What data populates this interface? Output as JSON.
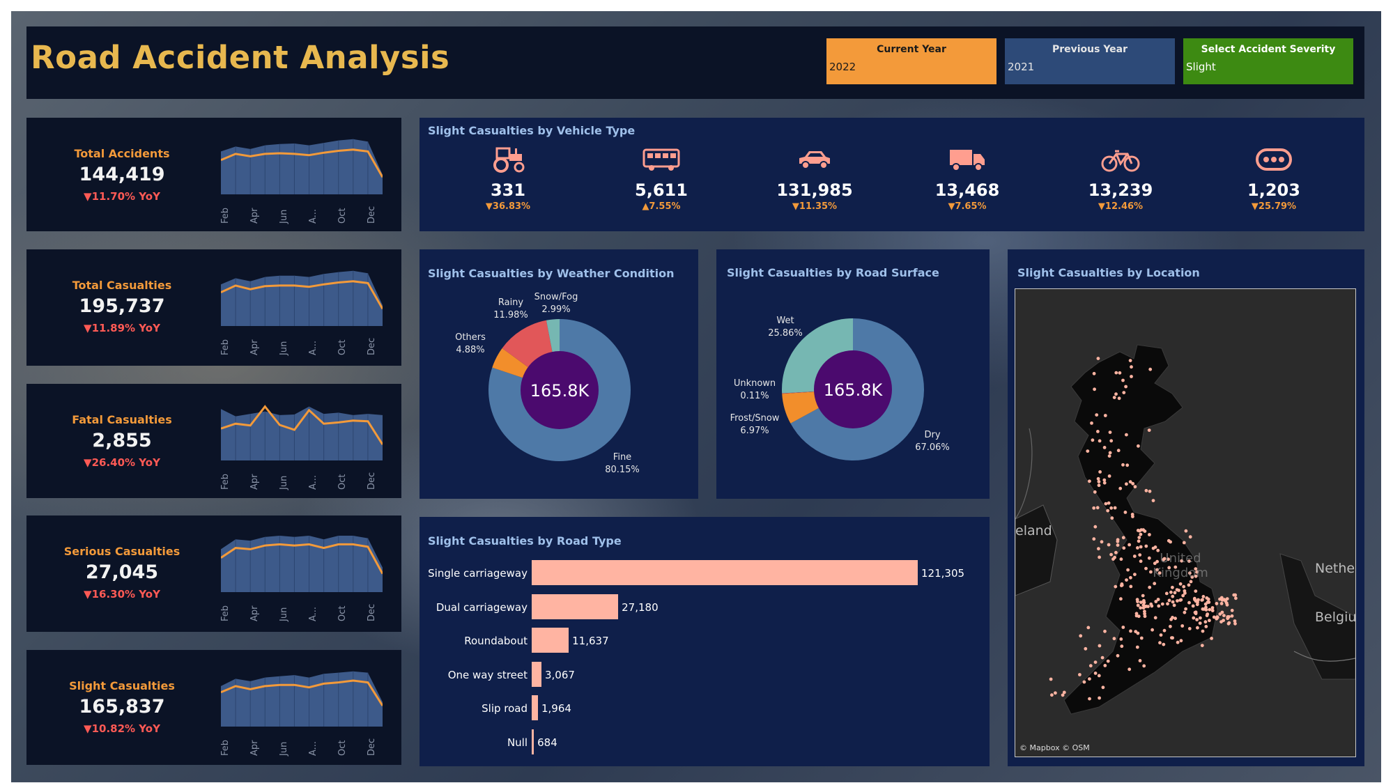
{
  "header": {
    "title": "Road Accident Analysis",
    "filters": [
      {
        "label": "Current Year",
        "value": "2022",
        "color": "#f39a3a",
        "text_color": "#1a1a1a"
      },
      {
        "label": "Previous Year",
        "value": "2021",
        "color": "#2d4a78",
        "text_color": "#e6e6e6"
      },
      {
        "label": "Select Accident Severity",
        "value": "Slight",
        "color": "#3d8a12",
        "text_color": "#ffffff"
      }
    ]
  },
  "kpis": [
    {
      "title": "Total Accidents",
      "value": "144,419",
      "yoy": "▼11.70% YoY",
      "area": [
        0.7,
        0.78,
        0.74,
        0.8,
        0.82,
        0.83,
        0.8,
        0.84,
        0.88,
        0.9,
        0.86,
        0.32
      ],
      "line": [
        0.56,
        0.66,
        0.62,
        0.66,
        0.67,
        0.66,
        0.64,
        0.68,
        0.71,
        0.73,
        0.7,
        0.28
      ]
    },
    {
      "title": "Total Casualties",
      "value": "195,737",
      "yoy": "▼11.89% YoY",
      "area": [
        0.68,
        0.78,
        0.73,
        0.8,
        0.82,
        0.82,
        0.8,
        0.85,
        0.88,
        0.9,
        0.86,
        0.34
      ],
      "line": [
        0.55,
        0.66,
        0.6,
        0.65,
        0.66,
        0.66,
        0.64,
        0.68,
        0.71,
        0.73,
        0.7,
        0.28
      ]
    },
    {
      "title": "Fatal Casualties",
      "value": "2,855",
      "yoy": "▼26.40% YoY",
      "area": [
        0.84,
        0.72,
        0.76,
        0.8,
        0.74,
        0.75,
        0.88,
        0.76,
        0.78,
        0.74,
        0.76,
        0.74
      ],
      "line": [
        0.52,
        0.6,
        0.57,
        0.88,
        0.58,
        0.5,
        0.82,
        0.6,
        0.62,
        0.65,
        0.64,
        0.26
      ]
    },
    {
      "title": "Serious Casualties",
      "value": "27,045",
      "yoy": "▼16.30% YoY",
      "area": [
        0.7,
        0.86,
        0.84,
        0.9,
        0.92,
        0.9,
        0.92,
        0.86,
        0.92,
        0.92,
        0.88,
        0.4
      ],
      "line": [
        0.56,
        0.72,
        0.7,
        0.76,
        0.78,
        0.76,
        0.78,
        0.72,
        0.78,
        0.78,
        0.74,
        0.3
      ]
    },
    {
      "title": "Slight Casualties",
      "value": "165,837",
      "yoy": "▼10.82% YoY",
      "area": [
        0.66,
        0.78,
        0.74,
        0.8,
        0.82,
        0.84,
        0.8,
        0.86,
        0.88,
        0.9,
        0.88,
        0.4
      ],
      "line": [
        0.56,
        0.66,
        0.61,
        0.66,
        0.68,
        0.68,
        0.64,
        0.7,
        0.72,
        0.75,
        0.72,
        0.34
      ]
    }
  ],
  "months": [
    "Feb",
    "Apr",
    "Jun",
    "A...",
    "Oct",
    "Dec"
  ],
  "vehicle": {
    "title": "Slight Casualties by Vehicle Type",
    "items": [
      {
        "icon": "tractor-icon",
        "value": "331",
        "yoy": "▼36.83%"
      },
      {
        "icon": "bus-icon",
        "value": "5,611",
        "yoy": "▲7.55%"
      },
      {
        "icon": "car-icon",
        "value": "131,985",
        "yoy": "▼11.35%"
      },
      {
        "icon": "truck-icon",
        "value": "13,468",
        "yoy": "▼7.65%"
      },
      {
        "icon": "bicycle-icon",
        "value": "13,239",
        "yoy": "▼12.46%"
      },
      {
        "icon": "more-icon",
        "value": "1,203",
        "yoy": "▼25.79%"
      }
    ]
  },
  "weather": {
    "title": "Slight Casualties by Weather Condition",
    "center": "165.8K",
    "labels": {
      "snow": [
        "Snow/Fog",
        "2.99%"
      ],
      "rainy": [
        "Rainy",
        "11.98%"
      ],
      "others": [
        "Others",
        "4.88%"
      ],
      "fine": [
        "Fine",
        "80.15%"
      ]
    }
  },
  "surface": {
    "title": "Slight Casualties by Road Surface",
    "center": "165.8K",
    "labels": {
      "wet": [
        "Wet",
        "25.86%"
      ],
      "unknown": [
        "Unknown",
        "0.11%"
      ],
      "frost": [
        "Frost/Snow",
        "6.97%"
      ],
      "dry": [
        "Dry",
        "67.06%"
      ]
    }
  },
  "location": {
    "title": "Slight Casualties by Location",
    "attribution": "© Mapbox © OSM",
    "map_labels": [
      "eland",
      "United Kingdom",
      "Nethe",
      "Belgiu"
    ]
  },
  "chart_data": [
    {
      "type": "pie",
      "title": "Slight Casualties by Weather Condition",
      "categories": [
        "Fine",
        "Others",
        "Rainy",
        "Snow/Fog"
      ],
      "values": [
        80.15,
        4.88,
        11.98,
        2.99
      ],
      "colors": [
        "#4e79a7",
        "#f28e2b",
        "#e15759",
        "#76b7b2"
      ]
    },
    {
      "type": "pie",
      "title": "Slight Casualties by Road Surface",
      "categories": [
        "Dry",
        "Frost/Snow",
        "Unknown",
        "Wet"
      ],
      "values": [
        67.06,
        6.97,
        0.11,
        25.86
      ],
      "colors": [
        "#4e79a7",
        "#f28e2b",
        "#e15759",
        "#76b7b2"
      ]
    },
    {
      "type": "bar",
      "title": "Slight Casualties by Road Type",
      "categories": [
        "Single carriageway",
        "Dual carriageway",
        "Roundabout",
        "One way street",
        "Slip road",
        "Null"
      ],
      "values": [
        121305,
        27180,
        11637,
        3067,
        1964,
        684
      ],
      "value_labels": [
        "121,305",
        "27,180",
        "11,637",
        "3,067",
        "1,964",
        "684"
      ],
      "color": "#ffb4a2"
    }
  ]
}
